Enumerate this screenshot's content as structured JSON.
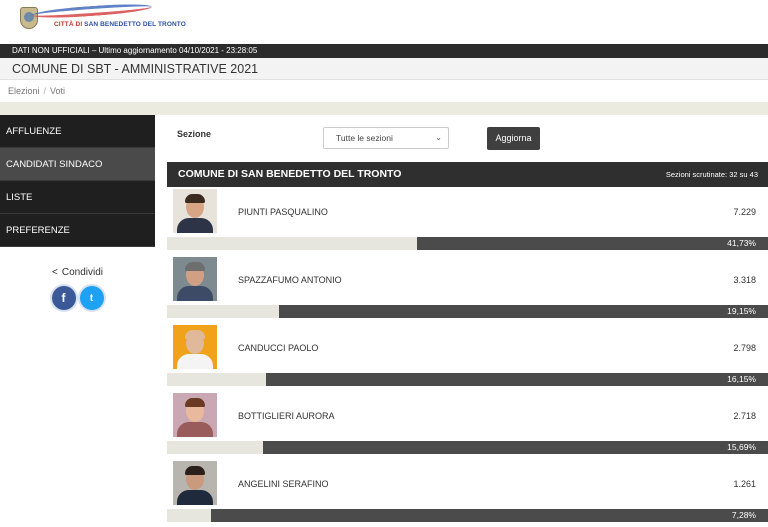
{
  "header": {
    "logo_city_prefix": "CITTÀ DI",
    "logo_city_name": "SAN BENEDETTO DEL TRONTO",
    "status_text": "DATI NON UFFICIALI – Ultimo aggiornamento 04/10/2021 - 23:28:05",
    "page_title": "COMUNE DI SBT - AMMINISTRATIVE 2021"
  },
  "breadcrumb": {
    "items": [
      "Elezioni",
      "Voti"
    ],
    "separator": "/"
  },
  "sidebar": {
    "items": [
      {
        "label": "AFFLUENZE",
        "active": false
      },
      {
        "label": "CANDIDATI SINDACO",
        "active": true
      },
      {
        "label": "LISTE",
        "active": false
      },
      {
        "label": "PREFERENZE",
        "active": false
      }
    ],
    "share_label": "Condividi",
    "share_icon": "share-icon",
    "social": [
      {
        "name": "facebook-icon",
        "glyph": "f",
        "color": "#3b5998"
      },
      {
        "name": "twitter-icon",
        "glyph": "t",
        "color": "#1da1f2"
      }
    ]
  },
  "filter": {
    "label": "Sezione",
    "select_value": "Tutte le sezioni",
    "button_label": "Aggiorna"
  },
  "results": {
    "title": "COMUNE DI SAN BENEDETTO DEL TRONTO",
    "sections_counted": "Sezioni scrutinate: 32 su 43",
    "candidates": [
      {
        "name": "PIUNTI PASQUALINO",
        "votes": "7.229",
        "percent": "41,73%",
        "fraction": 0.5835,
        "photo_bg": "#e7e3da",
        "skin": "#d8a487",
        "hair": "#3b2a20",
        "suit": "#2e3448"
      },
      {
        "name": "SPAZZAFUMO ANTONIO",
        "votes": "3.318",
        "percent": "19,15%",
        "fraction": 0.8135,
        "photo_bg": "#7d8a8f",
        "skin": "#d1a084",
        "hair": "#6e6e6e",
        "suit": "#3d4b66"
      },
      {
        "name": "CANDUCCI PAOLO",
        "votes": "2.798",
        "percent": "16,15%",
        "fraction": 0.8353,
        "photo_bg": "#f0a21a",
        "skin": "#e0b89a",
        "hair": "#e0b89a",
        "suit": "#f4f4f4"
      },
      {
        "name": "BOTTIGLIERI AURORA",
        "votes": "2.718",
        "percent": "15,69%",
        "fraction": 0.8403,
        "photo_bg": "#c9a8b3",
        "skin": "#e8b99d",
        "hair": "#6a3a22",
        "suit": "#9a5b5b"
      },
      {
        "name": "ANGELINI SERAFINO",
        "votes": "1.261",
        "percent": "7,28%",
        "fraction": 0.9268,
        "photo_bg": "#b8b5ae",
        "skin": "#c99a7d",
        "hair": "#2a1f1a",
        "suit": "#1f2a3c"
      }
    ]
  }
}
